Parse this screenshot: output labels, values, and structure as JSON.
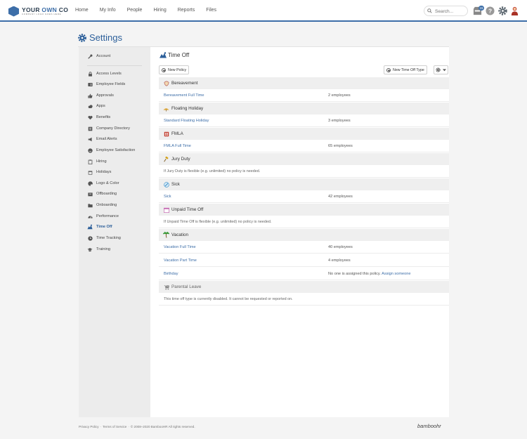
{
  "brand": {
    "name_part1": "YOUR ",
    "name_part2": "OWN",
    "name_part3": " CO",
    "tagline": "COMPANY LOGO GOES HERE"
  },
  "nav": [
    "Home",
    "My Info",
    "People",
    "Hiring",
    "Reports",
    "Files"
  ],
  "search": {
    "placeholder": "Search..."
  },
  "inbox_count": "15",
  "settings_title": "Settings",
  "sidebar": {
    "items": [
      {
        "label": "Account",
        "icon": "wrench-icon"
      },
      {
        "label": "Access Levels",
        "icon": "lock-icon"
      },
      {
        "label": "Employee Fields",
        "icon": "id-card-icon"
      },
      {
        "label": "Approvals",
        "icon": "thumbs-up-icon"
      },
      {
        "label": "Apps",
        "icon": "cloud-icon"
      },
      {
        "label": "Benefits",
        "icon": "heart-icon"
      },
      {
        "label": "Company Directory",
        "icon": "directory-icon"
      },
      {
        "label": "Email Alerts",
        "icon": "megaphone-icon"
      },
      {
        "label": "Employee Satisfaction",
        "icon": "smile-icon"
      },
      {
        "label": "Hiring",
        "icon": "clipboard-icon"
      },
      {
        "label": "Holidays",
        "icon": "calendar-icon"
      },
      {
        "label": "Logo & Color",
        "icon": "palette-icon"
      },
      {
        "label": "Offboarding",
        "icon": "box-icon"
      },
      {
        "label": "Onboarding",
        "icon": "folder-icon"
      },
      {
        "label": "Performance",
        "icon": "gauge-icon"
      },
      {
        "label": "Time Off",
        "icon": "time-off-icon",
        "active": true
      },
      {
        "label": "Time Tracking",
        "icon": "clock-icon"
      },
      {
        "label": "Training",
        "icon": "graduation-cap-icon"
      }
    ]
  },
  "main": {
    "title": "Time Off",
    "new_policy": "New Policy",
    "new_type": "New Time Off Type",
    "sections": [
      {
        "title": "Bereavement",
        "icon": "bereavement-icon",
        "color": "#a94442"
      },
      {
        "title": "Floating Holiday",
        "icon": "floating-icon",
        "color": "#e0a93b"
      },
      {
        "title": "FMLA",
        "icon": "fmla-icon",
        "color": "#c0392b"
      },
      {
        "title": "Jury Duty",
        "icon": "gavel-icon",
        "color": "#d4a017"
      },
      {
        "title": "Sick",
        "icon": "sick-icon",
        "color": "#3d8fc9"
      },
      {
        "title": "Unpaid Time Off",
        "icon": "unpaid-icon",
        "color": "#c76fb5"
      },
      {
        "title": "Vacation",
        "icon": "palm-icon",
        "color": "#3a9b3a"
      },
      {
        "title": "Parental Leave",
        "icon": "stroller-icon",
        "color": "#888888"
      }
    ],
    "rows": {
      "bereavement": {
        "link": "Bereavement Full Time",
        "count": "2 employees"
      },
      "floating": {
        "link": "Standard Floating Holiday",
        "count": "3 employees"
      },
      "fmla": {
        "link": "FMLA Full Time",
        "count": "65 employees"
      },
      "jury": {
        "note": "If Jury Duty is flexible (e.g. unlimited) no policy is needed."
      },
      "sick": {
        "link": "Sick",
        "count": "42 employees"
      },
      "unpaid": {
        "note": "If Unpaid Time Off is flexible (e.g. unlimited) no policy is needed."
      },
      "vacation_full": {
        "link": "Vacation Full Time",
        "count": "40 employees"
      },
      "vacation_part": {
        "link": "Vacation Part Time",
        "count": "4 employees"
      },
      "birthday": {
        "link": "Birthday",
        "count": "No one is assigned this policy.",
        "assign": "Assign someone"
      },
      "parental": {
        "note": "This time off type is currently disabled. It cannot be requested or reported on."
      }
    }
  },
  "footer": {
    "privacy": "Privacy Policy",
    "terms": "Terms of Service",
    "copyright": "© 2008–2020 BambooHR All rights reserved."
  },
  "footer_brand": "bamboohr"
}
